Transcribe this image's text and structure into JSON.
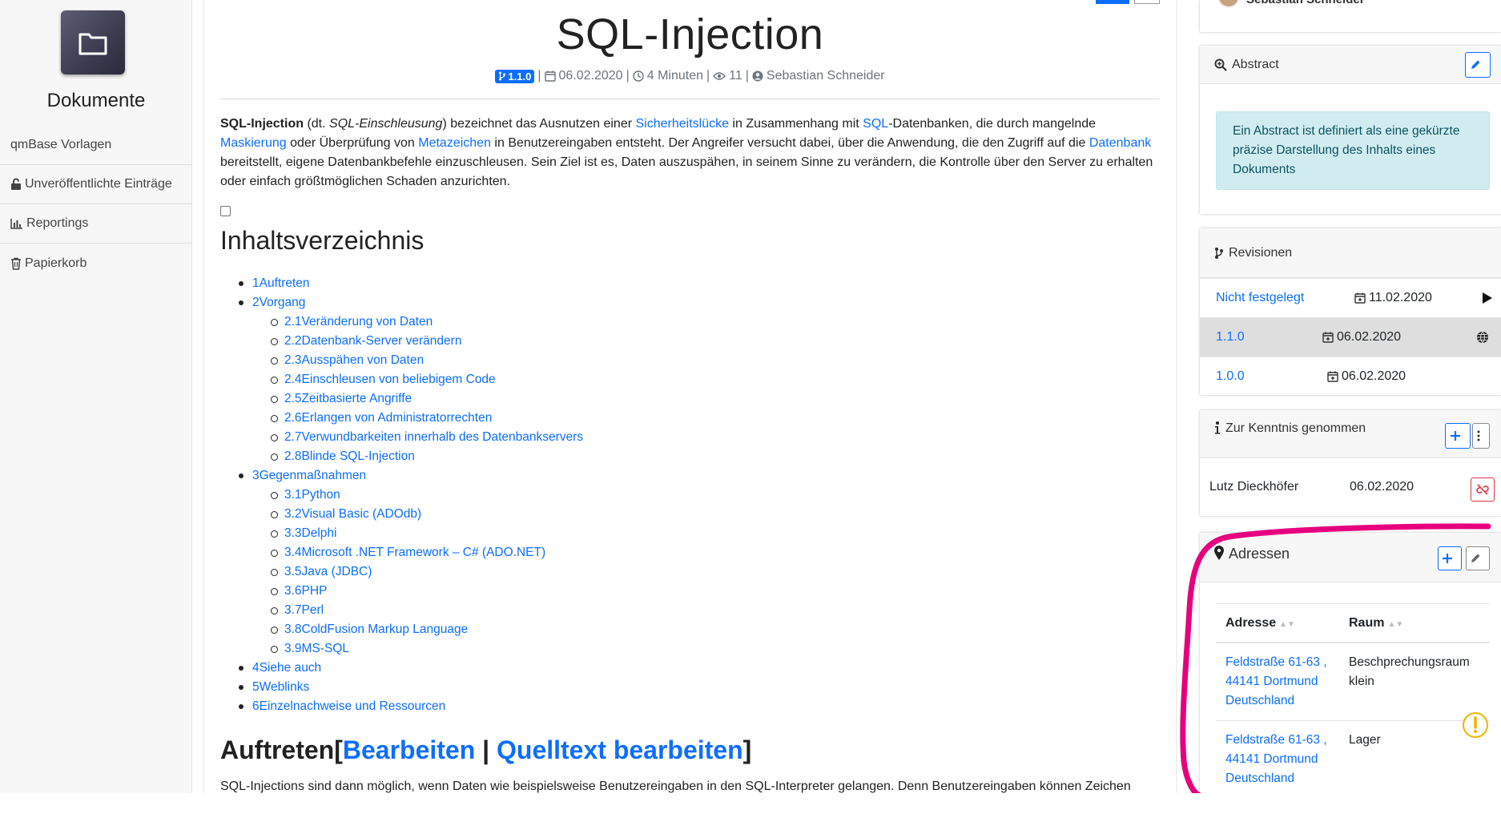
{
  "sidebar": {
    "title": "Dokumente",
    "icon": "folder-icon",
    "items": [
      {
        "label": "qmBase Vorlagen",
        "icon": ""
      },
      {
        "label": "Unveröffentlichte Einträge",
        "icon": "unlock-icon"
      },
      {
        "label": "Reportings",
        "icon": "bar-chart-icon"
      },
      {
        "label": "Papierkorb",
        "icon": "trash-icon"
      }
    ]
  },
  "document": {
    "title": "SQL-Injection",
    "meta": {
      "version": "1.1.0",
      "date": "06.02.2020",
      "reading_time": "4 Minuten",
      "views": "11",
      "author": "Sebastian Schneider",
      "separator": "|"
    },
    "intro": {
      "term": "SQL-Injection",
      "p1": " (dt. ",
      "term_de": "SQL-Einschleusung",
      "p2": ") bezeichnet das Ausnutzen einer ",
      "link1": "Sicherheitslücke",
      "p3": " in Zusammenhang mit ",
      "link2": "SQL",
      "p4": "-Datenbanken, die durch mangelnde ",
      "link3": "Maskierung",
      "p5": " oder Überprüfung von ",
      "link4": "Metazeichen",
      "p6": " in Benutzereingaben entsteht. Der Angreifer versucht dabei, über die Anwendung, die den Zugriff auf die ",
      "link5": "Datenbank",
      "p7": " bereitstellt, eigene Datenbankbefehle einzuschleusen. Sein Ziel ist es, Daten auszuspähen, in seinem Sinne zu verändern, die Kontrolle über den Server zu erhalten oder einfach größtmöglichen Schaden anzurichten."
    },
    "toc_title": "Inhaltsverzeichnis",
    "toc": [
      {
        "label": "1Auftreten",
        "children": []
      },
      {
        "label": "2Vorgang",
        "children": [
          "2.1Veränderung von Daten",
          "2.2Datenbank-Server verändern",
          "2.3Ausspähen von Daten",
          "2.4Einschleusen von beliebigem Code",
          "2.5Zeitbasierte Angriffe",
          "2.6Erlangen von Administratorrechten",
          "2.7Verwundbarkeiten innerhalb des Datenbankservers",
          "2.8Blinde SQL-Injection"
        ]
      },
      {
        "label": "3Gegenmaßnahmen",
        "children": [
          "3.1Python",
          "3.2Visual Basic (ADOdb)",
          "3.3Delphi",
          "3.4Microsoft .NET Framework – C# (ADO.NET)",
          "3.5Java (JDBC)",
          "3.6PHP",
          "3.7Perl",
          "3.8ColdFusion Markup Language",
          "3.9MS-SQL"
        ]
      },
      {
        "label": "4Siehe auch",
        "children": []
      },
      {
        "label": "5Weblinks",
        "children": []
      },
      {
        "label": "6Einzelnachweise und Ressourcen",
        "children": []
      }
    ],
    "section": {
      "title": "Auftreten",
      "bracket_open": "[",
      "edit_label": "Bearbeiten",
      "pipe": " | ",
      "source_label": "Quelltext bearbeiten",
      "bracket_close": "]",
      "text": "SQL-Injections sind dann möglich, wenn Daten wie beispielsweise Benutzereingaben in den SQL-Interpreter gelangen. Denn Benutzereingaben können Zeichen"
    }
  },
  "user_card": {
    "name": "Sebastian Schneider"
  },
  "abstract": {
    "title": "Abstract",
    "text": "Ein Abstract ist definiert als eine gekürzte präzise Darstellung des Inhalts eines Dokuments"
  },
  "revisions": {
    "title": "Revisionen",
    "rows": [
      {
        "version": "Nicht festgelegt",
        "date": "11.02.2020",
        "icon": "play-icon"
      },
      {
        "version": "1.1.0",
        "date": "06.02.2020",
        "icon": "globe-icon"
      },
      {
        "version": "1.0.0",
        "date": "06.02.2020",
        "icon": ""
      }
    ]
  },
  "acknowledged": {
    "title": "Zur Kenntnis genommen",
    "rows": [
      {
        "name": "Lutz Dieckhöfer",
        "date": "06.02.2020"
      }
    ]
  },
  "addresses": {
    "title": "Adressen",
    "col_address": "Adresse",
    "col_room": "Raum",
    "rows": [
      {
        "line1": "Feldstraße 61-63 ,",
        "line2": "44141 Dortmund",
        "line3": "Deutschland",
        "room1": "Beschprechungsraum",
        "room2": "klein"
      },
      {
        "line1": "Feldstraße 61-63 ,",
        "line2": "44141 Dortmund",
        "line3": "Deutschland",
        "room1": "Lager",
        "room2": ""
      }
    ]
  },
  "colors": {
    "accent": "#0d6efd",
    "annotation": "#e6007e",
    "warning": "#f0b400",
    "danger": "#dc3545"
  }
}
